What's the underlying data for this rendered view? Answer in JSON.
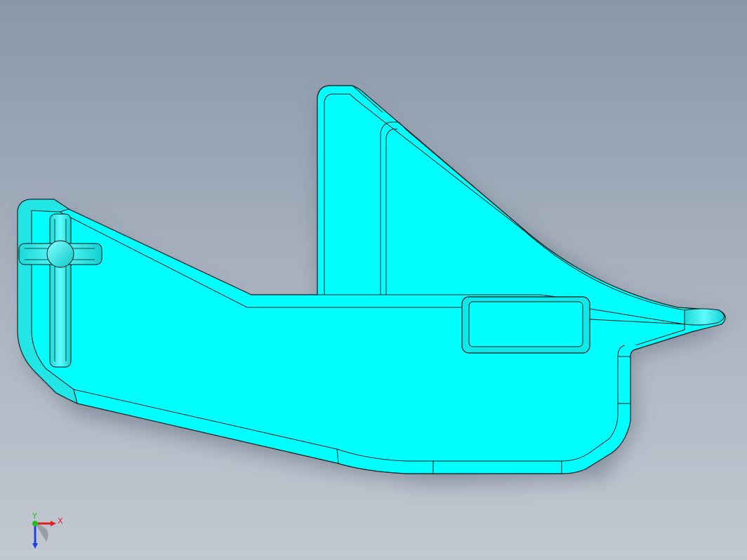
{
  "viewport": {
    "background_top": "#8a97a9",
    "background_bottom": "#c2c8d1"
  },
  "part": {
    "face_color": "#00ffff",
    "edge_color": "#0a1a1a",
    "shadow_color": "#6f7c8c",
    "description_icon": "sheet-metal-part"
  },
  "triad": {
    "x_label": "X",
    "y_label": "Y",
    "x_color": "#e02020",
    "y_color": "#20c020",
    "z_color": "#2040e0"
  }
}
